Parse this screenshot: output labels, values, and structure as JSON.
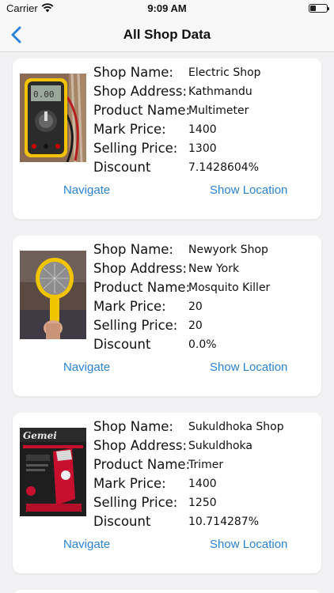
{
  "status_bar": {
    "carrier": "Carrier",
    "time": "9:09 AM",
    "battery_level": 0.35
  },
  "nav": {
    "title": "All Shop Data",
    "back_icon": "chevron-left-icon"
  },
  "labels": {
    "shop_name": "Shop Name:",
    "shop_address": "Shop Address:",
    "product_name": "Product Name:",
    "mark_price": "Mark Price:",
    "selling_price": "Selling Price:",
    "discount": "Discount"
  },
  "shops": [
    {
      "shop_name": "Electric Shop",
      "shop_address": "Kathmandu",
      "product_name": "Multimeter",
      "mark_price": "1400",
      "selling_price": "1300",
      "discount": "7.1428604%",
      "navigate_label": "Navigate",
      "location_label": "Show Location"
    },
    {
      "shop_name": "Newyork Shop",
      "shop_address": "New York",
      "product_name": "Mosquito Killer",
      "mark_price": "20",
      "selling_price": "20",
      "discount": "0.0%",
      "navigate_label": "Navigate",
      "location_label": "Show Location"
    },
    {
      "shop_name": "Sukuldhoka Shop",
      "shop_address": "Sukuldhoka",
      "product_name": "Trimer",
      "mark_price": "1400",
      "selling_price": "1250",
      "discount": "10.714287%",
      "navigate_label": "Navigate",
      "location_label": "Show Location",
      "image_brand_text": "Gemei"
    }
  ],
  "colors": {
    "link": "#2b83d6",
    "background": "#f2f2f4",
    "card": "#ffffff"
  }
}
